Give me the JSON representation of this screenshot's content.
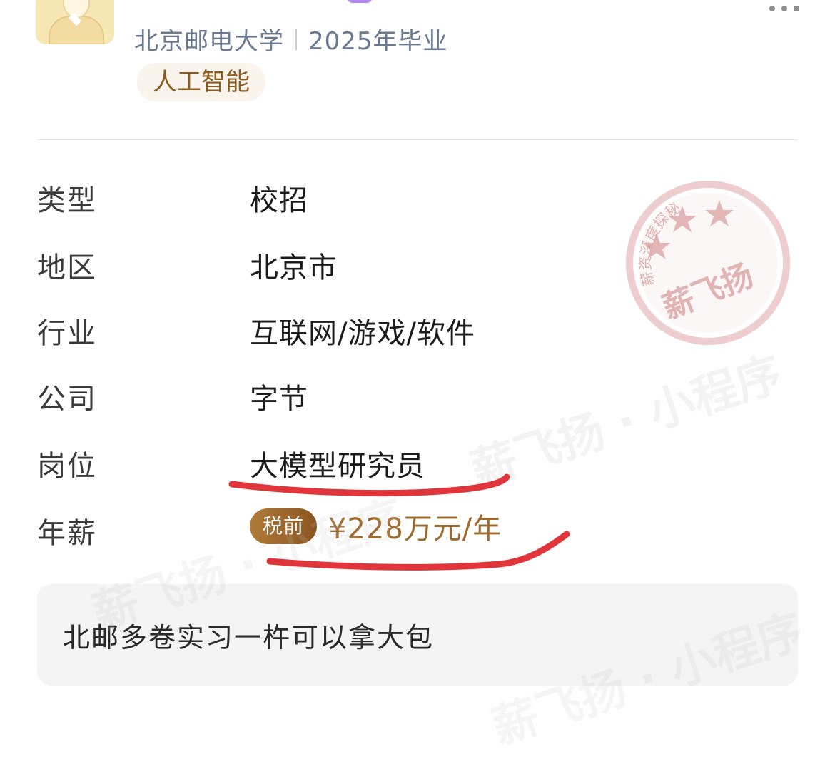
{
  "header": {
    "school": "北京邮电大学",
    "graduation": "2025年毕业",
    "tag": "人工智能"
  },
  "details": {
    "rows": [
      {
        "label": "类型",
        "value": "校招"
      },
      {
        "label": "地区",
        "value": "北京市"
      },
      {
        "label": "行业",
        "value": "互联网/游戏/软件"
      },
      {
        "label": "公司",
        "value": "字节"
      },
      {
        "label": "岗位",
        "value": "大模型研究员"
      }
    ],
    "salary_label": "年薪",
    "salary_badge": "税前",
    "salary_value": "¥228万元/年"
  },
  "note": "北邮多卷实习一杵可以拿大包",
  "stamp": {
    "top_text": "薪资深度探秘",
    "center_text": "薪飞扬"
  },
  "watermark": "薪飞扬 · 小程序",
  "colors": {
    "school_text": "#6a7a93",
    "tag_bg": "#fbf4ec",
    "tag_text": "#8a5a1f",
    "salary_text": "#a0692c",
    "badge_gradient_start": "#b07a38",
    "badge_gradient_end": "#8a5520",
    "annotation_red": "#e0353a",
    "stamp_red": "#d98f8f"
  },
  "icons": [
    "avatar-illustration",
    "more-options-icon",
    "star-icon"
  ]
}
